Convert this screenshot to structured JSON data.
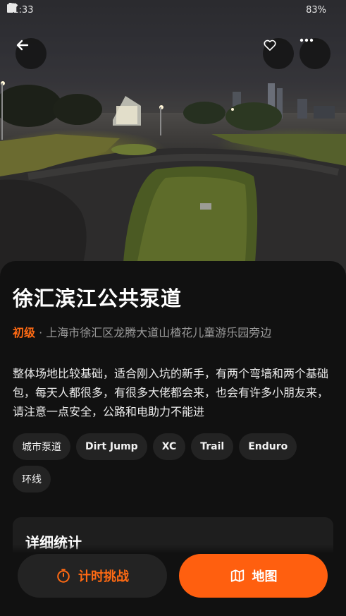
{
  "status_bar": {
    "time": "11:33",
    "battery_percent": "83%"
  },
  "park": {
    "name": "徐汇滨江公共泵道",
    "level": "初级",
    "separator": " · ",
    "address": "上海市徐汇区龙腾大道山楂花儿童游乐园旁边",
    "description": "整体场地比较基础，适合刚入坑的新手，有两个弯墙和两个基础包，每天人都很多，有很多大佬都会来，也会有许多小朋友来，请注意一点安全，公路和电助力不能进",
    "tags": [
      "城市泵道",
      "Dirt Jump",
      "XC",
      "Trail",
      "Enduro",
      "环线"
    ]
  },
  "stats": {
    "title": "详细统计"
  },
  "actions": {
    "timer_label": "计时挑战",
    "map_label": "地图"
  },
  "icons": {
    "back": "arrow-left-icon",
    "favorite": "heart-icon",
    "more": "more-horizontal-icon",
    "timer": "stopwatch-icon",
    "map": "map-icon",
    "wifi": "wifi-icon",
    "signal": "signal-icon",
    "battery": "battery-icon"
  },
  "colors": {
    "accent": "#ff6a13",
    "primary_button": "#ff5f0f",
    "background": "#111111",
    "chip": "#232323",
    "card": "#1e1e1e",
    "muted_text": "#9a9a9a"
  }
}
